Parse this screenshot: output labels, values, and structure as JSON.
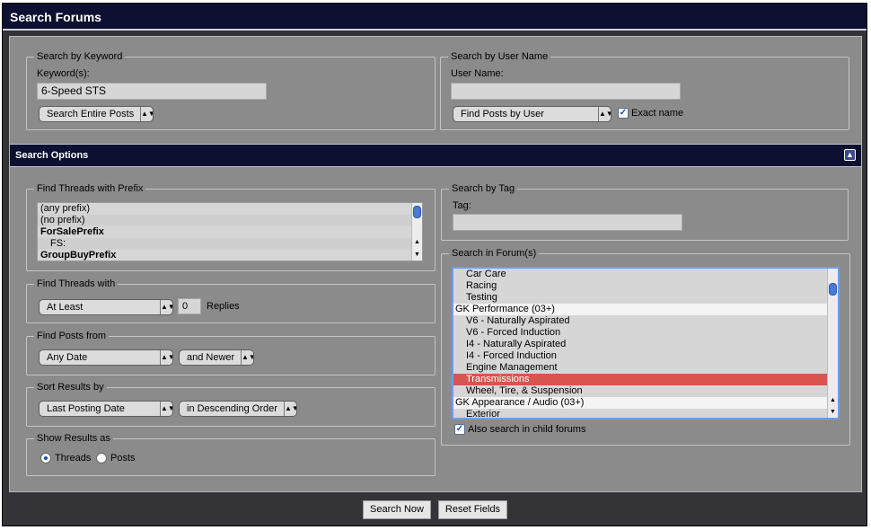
{
  "header": {
    "title": "Search Forums"
  },
  "keyword": {
    "legend": "Search by Keyword",
    "label": "Keyword(s):",
    "value": "6-Speed STS",
    "scope": "Search Entire Posts"
  },
  "username": {
    "legend": "Search by User Name",
    "label": "User Name:",
    "value": "",
    "mode": "Find Posts by User",
    "exact_label": "Exact name",
    "exact_checked": true
  },
  "options": {
    "title": "Search Options",
    "collapse_icon": "collapse-icon"
  },
  "prefix": {
    "legend": "Find Threads with Prefix",
    "items": [
      {
        "text": "(any prefix)",
        "bold": false
      },
      {
        "text": "(no prefix)",
        "bold": false
      },
      {
        "text": "ForSalePrefix",
        "bold": true
      },
      {
        "text": "FS:",
        "bold": false,
        "indent": true
      },
      {
        "text": "GroupBuyPrefix",
        "bold": true
      }
    ]
  },
  "threads_with": {
    "legend": "Find Threads with",
    "select": "At Least",
    "count": "0",
    "suffix": "Replies"
  },
  "posts_from": {
    "legend": "Find Posts from",
    "date": "Any Date",
    "relation": "and Newer"
  },
  "sort": {
    "legend": "Sort Results by",
    "field": "Last Posting Date",
    "order": "in Descending Order"
  },
  "show_as": {
    "legend": "Show Results as",
    "options": [
      {
        "label": "Threads",
        "selected": true
      },
      {
        "label": "Posts",
        "selected": false
      }
    ]
  },
  "tag": {
    "legend": "Search by Tag",
    "label": "Tag:",
    "value": ""
  },
  "forums": {
    "legend": "Search in Forum(s)",
    "items": [
      {
        "text": "Car Care",
        "level": 1,
        "style": "normal"
      },
      {
        "text": "Racing",
        "level": 1,
        "style": "normal"
      },
      {
        "text": "Testing",
        "level": 1,
        "style": "normal"
      },
      {
        "text": "GK Performance (03+)",
        "level": 0,
        "style": "category"
      },
      {
        "text": "V6 - Naturally Aspirated",
        "level": 1,
        "style": "normal"
      },
      {
        "text": "V6 - Forced Induction",
        "level": 1,
        "style": "normal"
      },
      {
        "text": "I4 - Naturally Aspirated",
        "level": 1,
        "style": "normal"
      },
      {
        "text": "I4 - Forced Induction",
        "level": 1,
        "style": "normal"
      },
      {
        "text": "Engine Management",
        "level": 1,
        "style": "normal"
      },
      {
        "text": "Transmissions",
        "level": 1,
        "style": "selected"
      },
      {
        "text": "Wheel, Tire, & Suspension",
        "level": 1,
        "style": "normal"
      },
      {
        "text": "GK Appearance / Audio (03+)",
        "level": 0,
        "style": "category"
      },
      {
        "text": "Exterior",
        "level": 1,
        "style": "normal"
      }
    ],
    "child_label": "Also search in child forums",
    "child_checked": true
  },
  "buttons": {
    "search": "Search Now",
    "reset": "Reset Fields"
  },
  "colors": {
    "header_bg": "#0d1030",
    "panel_bg": "#8b8b8b",
    "selected_row": "#d9534f",
    "scroll_thumb": "#4a7ad2"
  }
}
